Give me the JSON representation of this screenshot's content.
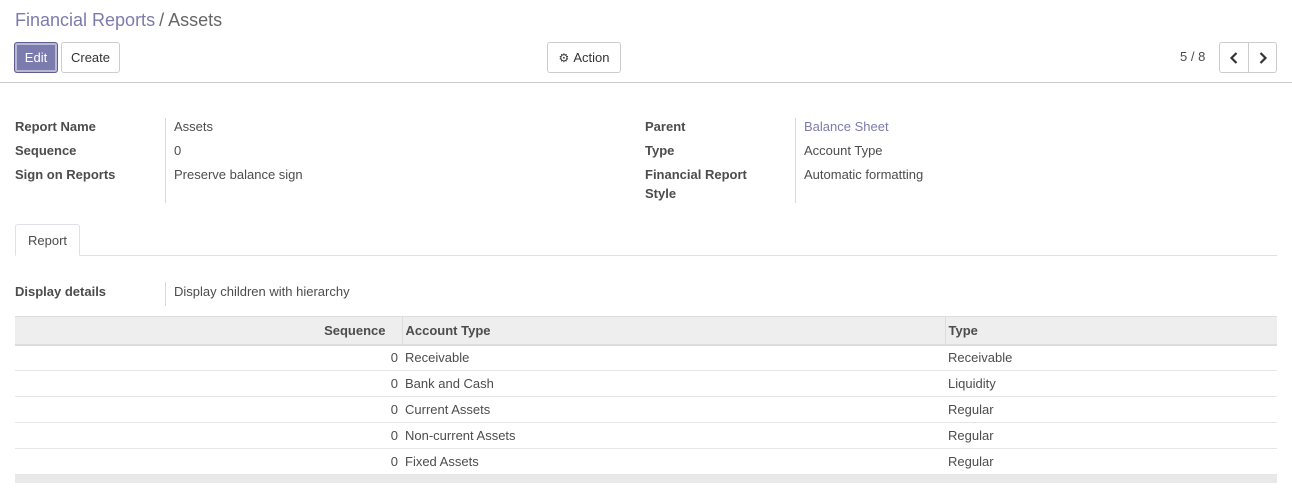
{
  "breadcrumb": {
    "parent": "Financial Reports",
    "separator": "/",
    "current": "Assets"
  },
  "buttons": {
    "edit": "Edit",
    "create": "Create",
    "action": "Action"
  },
  "pager": {
    "value": "5 / 8"
  },
  "fields": {
    "report_name": {
      "label": "Report Name",
      "value": "Assets"
    },
    "sequence": {
      "label": "Sequence",
      "value": "0"
    },
    "sign_on_reports": {
      "label": "Sign on Reports",
      "value": "Preserve balance sign"
    },
    "parent": {
      "label": "Parent",
      "value": "Balance Sheet"
    },
    "type": {
      "label": "Type",
      "value": "Account Type"
    },
    "style": {
      "label_line1": "Financial Report",
      "label_line2": "Style",
      "value": "Automatic formatting"
    },
    "display_details": {
      "label": "Display details",
      "value": "Display children with hierarchy"
    }
  },
  "tabs": [
    {
      "label": "Report"
    }
  ],
  "table": {
    "headers": {
      "sequence": "Sequence",
      "account_type": "Account Type",
      "type": "Type"
    },
    "rows": [
      {
        "sequence": "0",
        "account_type": "Receivable",
        "type": "Receivable"
      },
      {
        "sequence": "0",
        "account_type": "Bank and Cash",
        "type": "Liquidity"
      },
      {
        "sequence": "0",
        "account_type": "Current Assets",
        "type": "Regular"
      },
      {
        "sequence": "0",
        "account_type": "Non-current Assets",
        "type": "Regular"
      },
      {
        "sequence": "0",
        "account_type": "Fixed Assets",
        "type": "Regular"
      }
    ]
  },
  "colors": {
    "accent": "#7c7bad",
    "text": "#4c4c4c",
    "border": "#dddddd"
  }
}
